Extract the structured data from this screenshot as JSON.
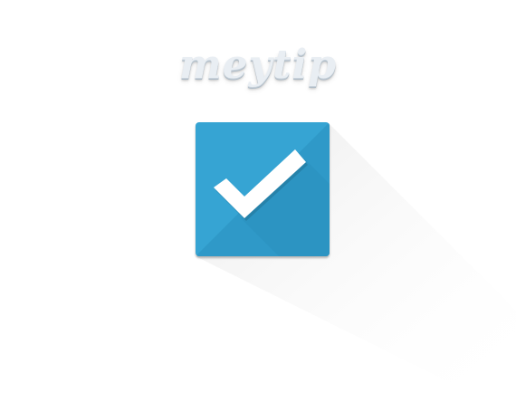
{
  "brand": {
    "name": "meytip"
  },
  "icon": {
    "semantic": "checkmark-icon",
    "accent_color": "#36a4d3"
  }
}
